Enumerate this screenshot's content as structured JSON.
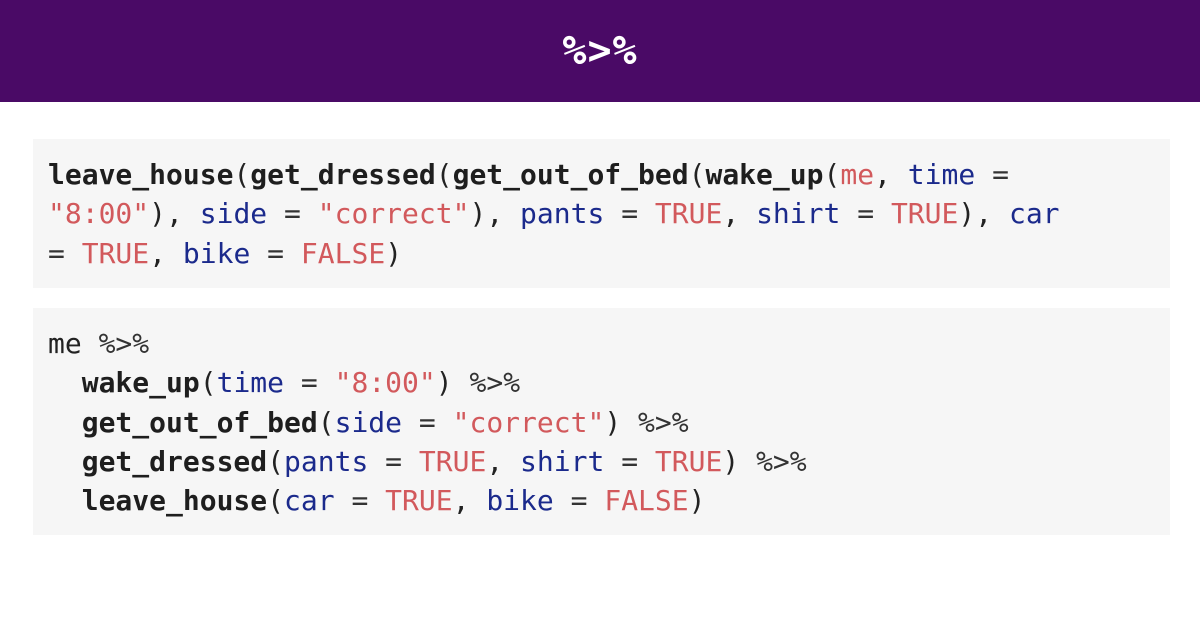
{
  "header": {
    "title": "%>%"
  },
  "nested_code": {
    "line1": [
      {
        "t": "leave_house",
        "k": "fn"
      },
      {
        "t": "(",
        "k": "plain"
      },
      {
        "t": "get_dressed",
        "k": "fn"
      },
      {
        "t": "(",
        "k": "plain"
      },
      {
        "t": "get_out_of_bed",
        "k": "fn"
      },
      {
        "t": "(",
        "k": "plain"
      },
      {
        "t": "wake_up",
        "k": "fn"
      },
      {
        "t": "(",
        "k": "plain"
      },
      {
        "t": "me",
        "k": "str"
      },
      {
        "t": ", ",
        "k": "plain"
      },
      {
        "t": "time",
        "k": "arg"
      },
      {
        "t": " = ",
        "k": "op"
      }
    ],
    "line2": [
      {
        "t": "\"8:00\"",
        "k": "str"
      },
      {
        "t": "), ",
        "k": "plain"
      },
      {
        "t": "side",
        "k": "arg"
      },
      {
        "t": " = ",
        "k": "op"
      },
      {
        "t": "\"correct\"",
        "k": "str"
      },
      {
        "t": "), ",
        "k": "plain"
      },
      {
        "t": "pants",
        "k": "arg"
      },
      {
        "t": " = ",
        "k": "op"
      },
      {
        "t": "TRUE",
        "k": "kw"
      },
      {
        "t": ", ",
        "k": "plain"
      },
      {
        "t": "shirt",
        "k": "arg"
      },
      {
        "t": " = ",
        "k": "op"
      },
      {
        "t": "TRUE",
        "k": "kw"
      },
      {
        "t": "), ",
        "k": "plain"
      },
      {
        "t": "car",
        "k": "arg"
      }
    ],
    "line3": [
      {
        "t": "= ",
        "k": "op"
      },
      {
        "t": "TRUE",
        "k": "kw"
      },
      {
        "t": ", ",
        "k": "plain"
      },
      {
        "t": "bike",
        "k": "arg"
      },
      {
        "t": " = ",
        "k": "op"
      },
      {
        "t": "FALSE",
        "k": "kw"
      },
      {
        "t": ")",
        "k": "plain"
      }
    ]
  },
  "piped_code": {
    "line1": [
      {
        "t": "me ",
        "k": "plain"
      },
      {
        "t": "%>%",
        "k": "op"
      }
    ],
    "line2": [
      {
        "t": "  ",
        "k": "plain"
      },
      {
        "t": "wake_up",
        "k": "fn"
      },
      {
        "t": "(",
        "k": "plain"
      },
      {
        "t": "time",
        "k": "arg"
      },
      {
        "t": " = ",
        "k": "op"
      },
      {
        "t": "\"8:00\"",
        "k": "str"
      },
      {
        "t": ") ",
        "k": "plain"
      },
      {
        "t": "%>%",
        "k": "op"
      }
    ],
    "line3": [
      {
        "t": "  ",
        "k": "plain"
      },
      {
        "t": "get_out_of_bed",
        "k": "fn"
      },
      {
        "t": "(",
        "k": "plain"
      },
      {
        "t": "side",
        "k": "arg"
      },
      {
        "t": " = ",
        "k": "op"
      },
      {
        "t": "\"correct\"",
        "k": "str"
      },
      {
        "t": ") ",
        "k": "plain"
      },
      {
        "t": "%>%",
        "k": "op"
      }
    ],
    "line4": [
      {
        "t": "  ",
        "k": "plain"
      },
      {
        "t": "get_dressed",
        "k": "fn"
      },
      {
        "t": "(",
        "k": "plain"
      },
      {
        "t": "pants",
        "k": "arg"
      },
      {
        "t": " = ",
        "k": "op"
      },
      {
        "t": "TRUE",
        "k": "kw"
      },
      {
        "t": ", ",
        "k": "plain"
      },
      {
        "t": "shirt",
        "k": "arg"
      },
      {
        "t": " = ",
        "k": "op"
      },
      {
        "t": "TRUE",
        "k": "kw"
      },
      {
        "t": ") ",
        "k": "plain"
      },
      {
        "t": "%>%",
        "k": "op"
      }
    ],
    "line5": [
      {
        "t": "  ",
        "k": "plain"
      },
      {
        "t": "leave_house",
        "k": "fn"
      },
      {
        "t": "(",
        "k": "plain"
      },
      {
        "t": "car",
        "k": "arg"
      },
      {
        "t": " = ",
        "k": "op"
      },
      {
        "t": "TRUE",
        "k": "kw"
      },
      {
        "t": ", ",
        "k": "plain"
      },
      {
        "t": "bike",
        "k": "arg"
      },
      {
        "t": " = ",
        "k": "op"
      },
      {
        "t": "FALSE",
        "k": "kw"
      },
      {
        "t": ")",
        "k": "plain"
      }
    ]
  },
  "colors": {
    "header_bg": "#4a0a66",
    "code_bg": "#f6f6f6",
    "string_literal": "#d2595c",
    "argument_name": "#1b2a8c"
  }
}
